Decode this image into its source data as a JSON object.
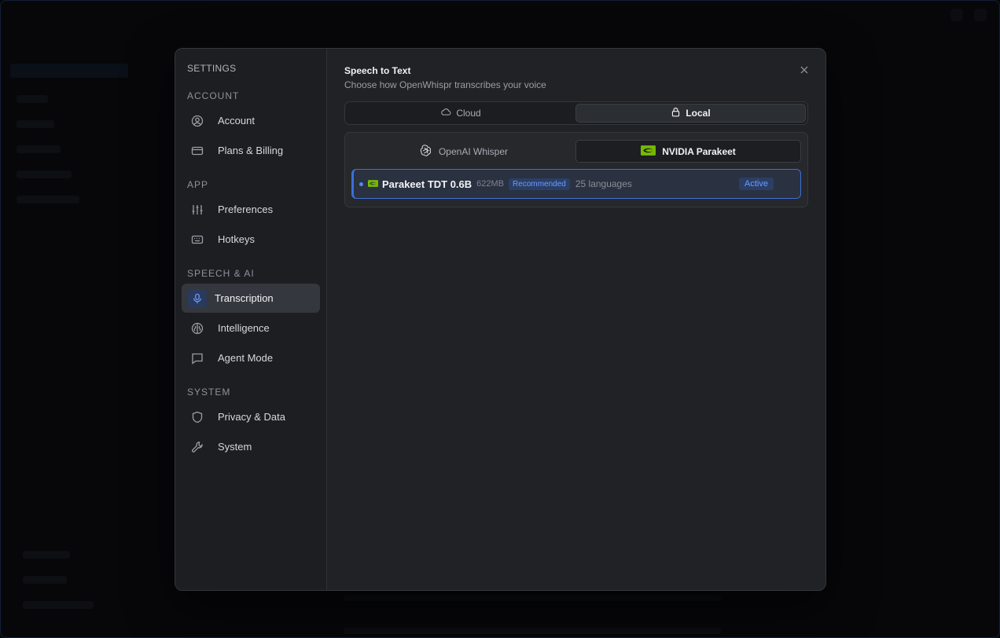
{
  "colors": {
    "accent": "#3d6fd9",
    "nvidia_green": "#76b900",
    "modal_bg": "#202226",
    "sidebar_bg": "#1c1e21"
  },
  "sidebar": {
    "title": "SETTINGS",
    "sections": [
      {
        "label": "ACCOUNT",
        "items": [
          {
            "label": "Account",
            "icon": "user-circle-icon"
          },
          {
            "label": "Plans & Billing",
            "icon": "credit-card-icon"
          }
        ]
      },
      {
        "label": "APP",
        "items": [
          {
            "label": "Preferences",
            "icon": "sliders-icon"
          },
          {
            "label": "Hotkeys",
            "icon": "keyboard-icon"
          }
        ]
      },
      {
        "label": "SPEECH & AI",
        "items": [
          {
            "label": "Transcription",
            "icon": "microphone-icon",
            "active": true
          },
          {
            "label": "Intelligence",
            "icon": "brain-icon"
          },
          {
            "label": "Agent Mode",
            "icon": "chat-bubble-icon"
          }
        ]
      },
      {
        "label": "SYSTEM",
        "items": [
          {
            "label": "Privacy & Data",
            "icon": "shield-icon"
          },
          {
            "label": "System",
            "icon": "wrench-icon"
          }
        ]
      }
    ]
  },
  "main": {
    "title": "Speech to Text",
    "subtitle": "Choose how OpenWhispr transcribes your voice",
    "mode_tabs": [
      {
        "label": "Cloud",
        "icon": "cloud-icon",
        "selected": false
      },
      {
        "label": "Local",
        "icon": "lock-icon",
        "selected": true
      }
    ],
    "engine_tabs": [
      {
        "label": "OpenAI Whisper",
        "icon": "openai-icon",
        "selected": false
      },
      {
        "label": "NVIDIA Parakeet",
        "icon": "nvidia-icon",
        "selected": true
      }
    ],
    "model": {
      "name": "Parakeet TDT 0.6B",
      "size": "622MB",
      "badge": "Recommended",
      "languages": "25 languages",
      "status": "Active"
    }
  }
}
